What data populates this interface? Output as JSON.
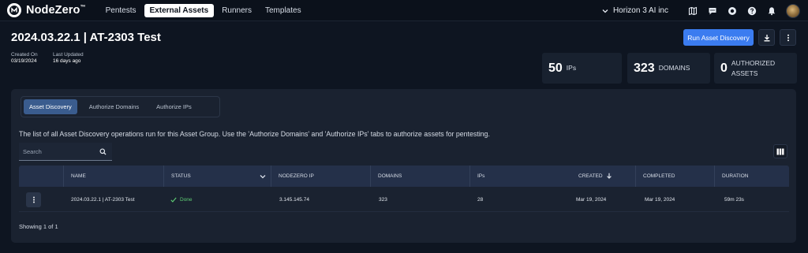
{
  "nav": {
    "brand": "NodeZero",
    "brand_mark": "™",
    "links": [
      "Pentests",
      "External Assets",
      "Runners",
      "Templates"
    ],
    "active_link": "External Assets",
    "org": "Horizon 3 AI inc",
    "icons": [
      "chevron-down-icon",
      "map-icon",
      "chat-icon",
      "support-icon",
      "help-icon",
      "bell-icon"
    ]
  },
  "header": {
    "title": "2024.03.22.1 | AT-2303 Test",
    "created_label": "Created On",
    "created_value": "03/19/2024",
    "updated_label": "Last Updated",
    "updated_value": "16 days ago",
    "primary_button": "Run Asset Discovery"
  },
  "stats": {
    "ips_num": "50",
    "ips_label": "IPs",
    "domains_num": "323",
    "domains_label": "DOMAINS",
    "authorized_num": "0",
    "authorized_label_1": "AUTHORIZED",
    "authorized_label_2": "ASSETS"
  },
  "tabs": [
    "Asset Discovery",
    "Authorize Domains",
    "Authorize IPs"
  ],
  "active_tab": "Asset Discovery",
  "description": "The list of all Asset Discovery operations run for this Asset Group. Use the 'Authorize Domains' and 'Authorize IPs' tabs to authorize assets for pentesting.",
  "search": {
    "placeholder": "Search"
  },
  "table": {
    "columns": [
      "NAME",
      "STATUS",
      "NODEZERO IP",
      "DOMAINS",
      "IPs",
      "CREATED",
      "COMPLETED",
      "DURATION"
    ],
    "rows": [
      {
        "name": "2024.03.22.1 | AT-2303 Test",
        "status": "Done",
        "nodezero_ip": "3.145.145.74",
        "domains": "323",
        "ips": "28",
        "created": "Mar 19, 2024",
        "completed": "Mar 19, 2024",
        "duration": "59m 23s"
      }
    ],
    "footer": "Showing 1 of 1"
  },
  "colors": {
    "background": "#0e1521",
    "panel": "#1a2230",
    "accent": "#3b7cf0",
    "success": "#5fcf74"
  }
}
